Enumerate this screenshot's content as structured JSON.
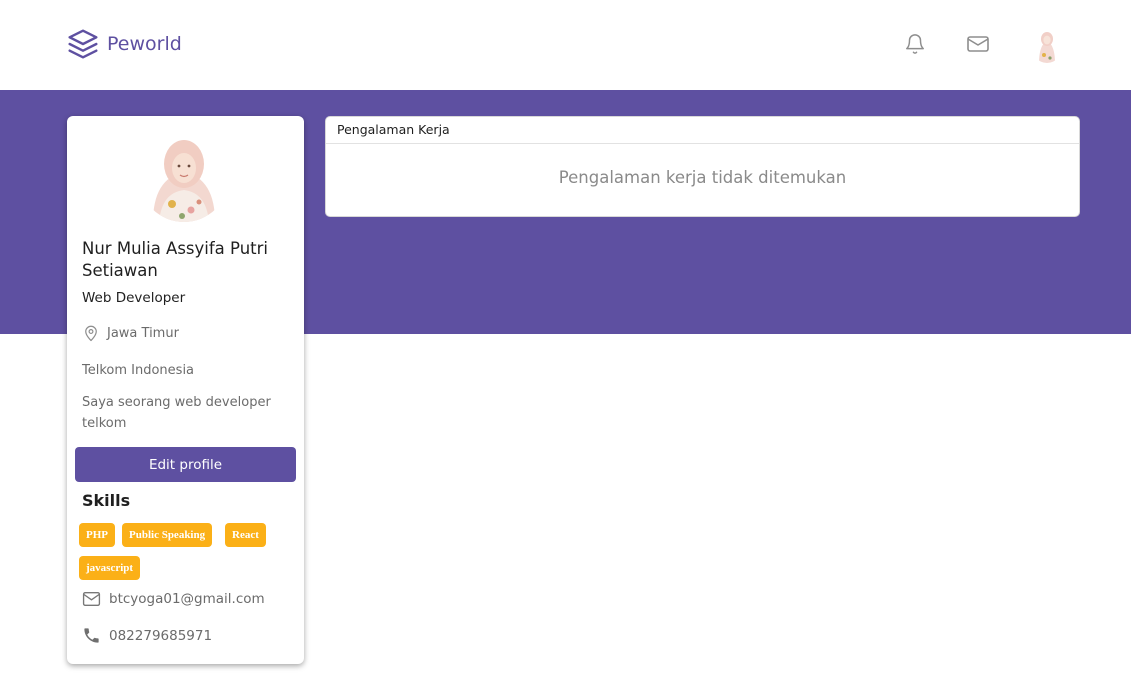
{
  "navbar": {
    "brand": "Peworld",
    "icons": [
      "bell-icon",
      "mail-icon"
    ],
    "brand_color": "#5e50a1"
  },
  "banner": {
    "color": "#5e50a1"
  },
  "profile": {
    "name": "Nur Mulia Assyifa Putri Setiawan",
    "job": "Web Developer",
    "location": "Jawa Timur",
    "workplace": "Telkom Indonesia",
    "bio": "Saya seorang web developer telkom",
    "edit_button": "Edit profile",
    "skills_title": "Skills",
    "skills": [
      "PHP",
      "Public Speaking",
      "React",
      "javascript"
    ],
    "skill_color": "#fbb017",
    "email": "btcyoga01@gmail.com",
    "phone": "082279685971"
  },
  "experience": {
    "title": "Pengalaman Kerja",
    "empty_message": "Pengalaman kerja tidak ditemukan"
  }
}
